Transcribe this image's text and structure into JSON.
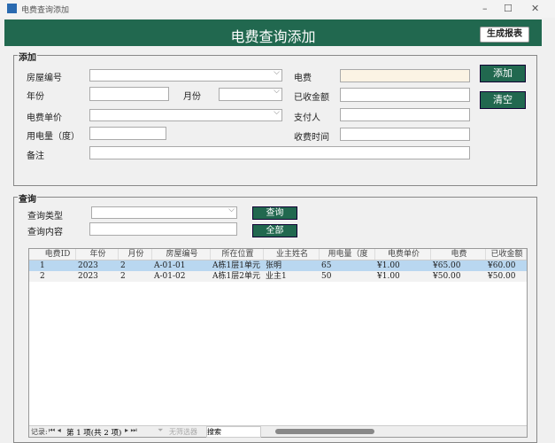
{
  "window": {
    "title": "电费查询添加",
    "minimize": "–",
    "maximize": "☐",
    "close": "✕"
  },
  "header": {
    "title": "电费查询添加",
    "report_button": "生成报表"
  },
  "add": {
    "legend": "添加",
    "house_no": "房屋编号",
    "year": "年份",
    "month": "月份",
    "unit_price": "电费单价",
    "usage": "用电量（度）",
    "remark": "备注",
    "fee": "电费",
    "received": "已收金额",
    "payer": "支付人",
    "pay_time": "收费时间",
    "add_button": "添加",
    "clear_button": "清空"
  },
  "query": {
    "legend": "查询",
    "type_label": "查询类型",
    "content_label": "查询内容",
    "query_button": "查询",
    "all_button": "全部"
  },
  "grid": {
    "columns": [
      "电费ID",
      "年份",
      "月份",
      "房屋编号",
      "所在位置",
      "业主姓名",
      "用电量（度",
      "电费单价",
      "电费",
      "已收金额"
    ],
    "rows": [
      [
        "1",
        "2023",
        "2",
        "A-01-01",
        "A栋1层1单元",
        "张明",
        "65",
        "¥1.00",
        "¥65.00",
        "¥60.00"
      ],
      [
        "2",
        "2023",
        "2",
        "A-01-02",
        "A栋1层2单元",
        "业主1",
        "50",
        "¥1.00",
        "¥50.00",
        "¥50.00"
      ]
    ]
  },
  "nav": {
    "record_label": "记录:",
    "position": "第 1 项(共 2 项)",
    "filter": "无筛选器",
    "search": "搜索"
  }
}
